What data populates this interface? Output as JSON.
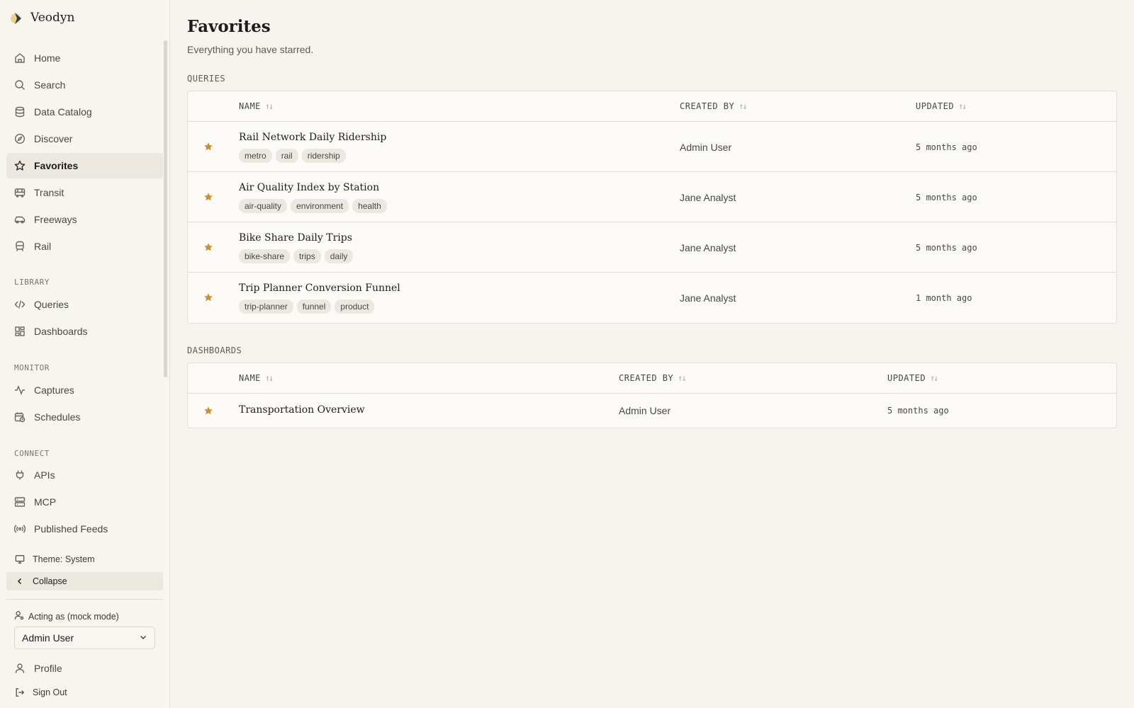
{
  "app": {
    "name": "Veodyn"
  },
  "nav": [
    {
      "label": "Home",
      "icon": "home-icon"
    },
    {
      "label": "Search",
      "icon": "search-icon"
    },
    {
      "label": "Data Catalog",
      "icon": "database-icon"
    },
    {
      "label": "Discover",
      "icon": "compass-icon"
    },
    {
      "label": "Favorites",
      "icon": "star-icon",
      "active": true
    },
    {
      "label": "Transit",
      "icon": "bus-icon"
    },
    {
      "label": "Freeways",
      "icon": "car-icon"
    },
    {
      "label": "Rail",
      "icon": "train-icon"
    }
  ],
  "library": {
    "label": "LIBRARY",
    "items": [
      {
        "label": "Queries",
        "icon": "code-icon"
      },
      {
        "label": "Dashboards",
        "icon": "dashboard-icon"
      }
    ]
  },
  "monitor": {
    "label": "MONITOR",
    "items": [
      {
        "label": "Captures",
        "icon": "activity-icon"
      },
      {
        "label": "Schedules",
        "icon": "calendar-clock-icon"
      }
    ]
  },
  "connect": {
    "label": "CONNECT",
    "items": [
      {
        "label": "APIs",
        "icon": "plug-icon"
      },
      {
        "label": "MCP",
        "icon": "server-icon"
      },
      {
        "label": "Published Feeds",
        "icon": "radio-icon"
      }
    ]
  },
  "footer": {
    "theme": "Theme: System",
    "collapse": "Collapse",
    "acting_as": "Acting as (mock mode)",
    "user": "Admin User",
    "profile": "Profile",
    "sign_out": "Sign Out"
  },
  "page": {
    "title": "Favorites",
    "subtitle": "Everything you have starred."
  },
  "queries": {
    "label": "QUERIES",
    "columns": {
      "name": "NAME",
      "created_by": "CREATED BY",
      "updated": "UPDATED"
    },
    "rows": [
      {
        "name": "Rail Network Daily Ridership",
        "tags": [
          "metro",
          "rail",
          "ridership"
        ],
        "created_by": "Admin User",
        "updated": "5 months ago"
      },
      {
        "name": "Air Quality Index by Station",
        "tags": [
          "air-quality",
          "environment",
          "health"
        ],
        "created_by": "Jane Analyst",
        "updated": "5 months ago"
      },
      {
        "name": "Bike Share Daily Trips",
        "tags": [
          "bike-share",
          "trips",
          "daily"
        ],
        "created_by": "Jane Analyst",
        "updated": "5 months ago"
      },
      {
        "name": "Trip Planner Conversion Funnel",
        "tags": [
          "trip-planner",
          "funnel",
          "product"
        ],
        "created_by": "Jane Analyst",
        "updated": "1 month ago"
      }
    ]
  },
  "dashboards": {
    "label": "DASHBOARDS",
    "columns": {
      "name": "NAME",
      "created_by": "CREATED BY",
      "updated": "UPDATED"
    },
    "rows": [
      {
        "name": "Transportation Overview",
        "created_by": "Admin User",
        "updated": "5 months ago"
      }
    ]
  },
  "colors": {
    "star": "#c8912e",
    "active_bg": "#ece8df",
    "background": "#f5f4ef"
  }
}
